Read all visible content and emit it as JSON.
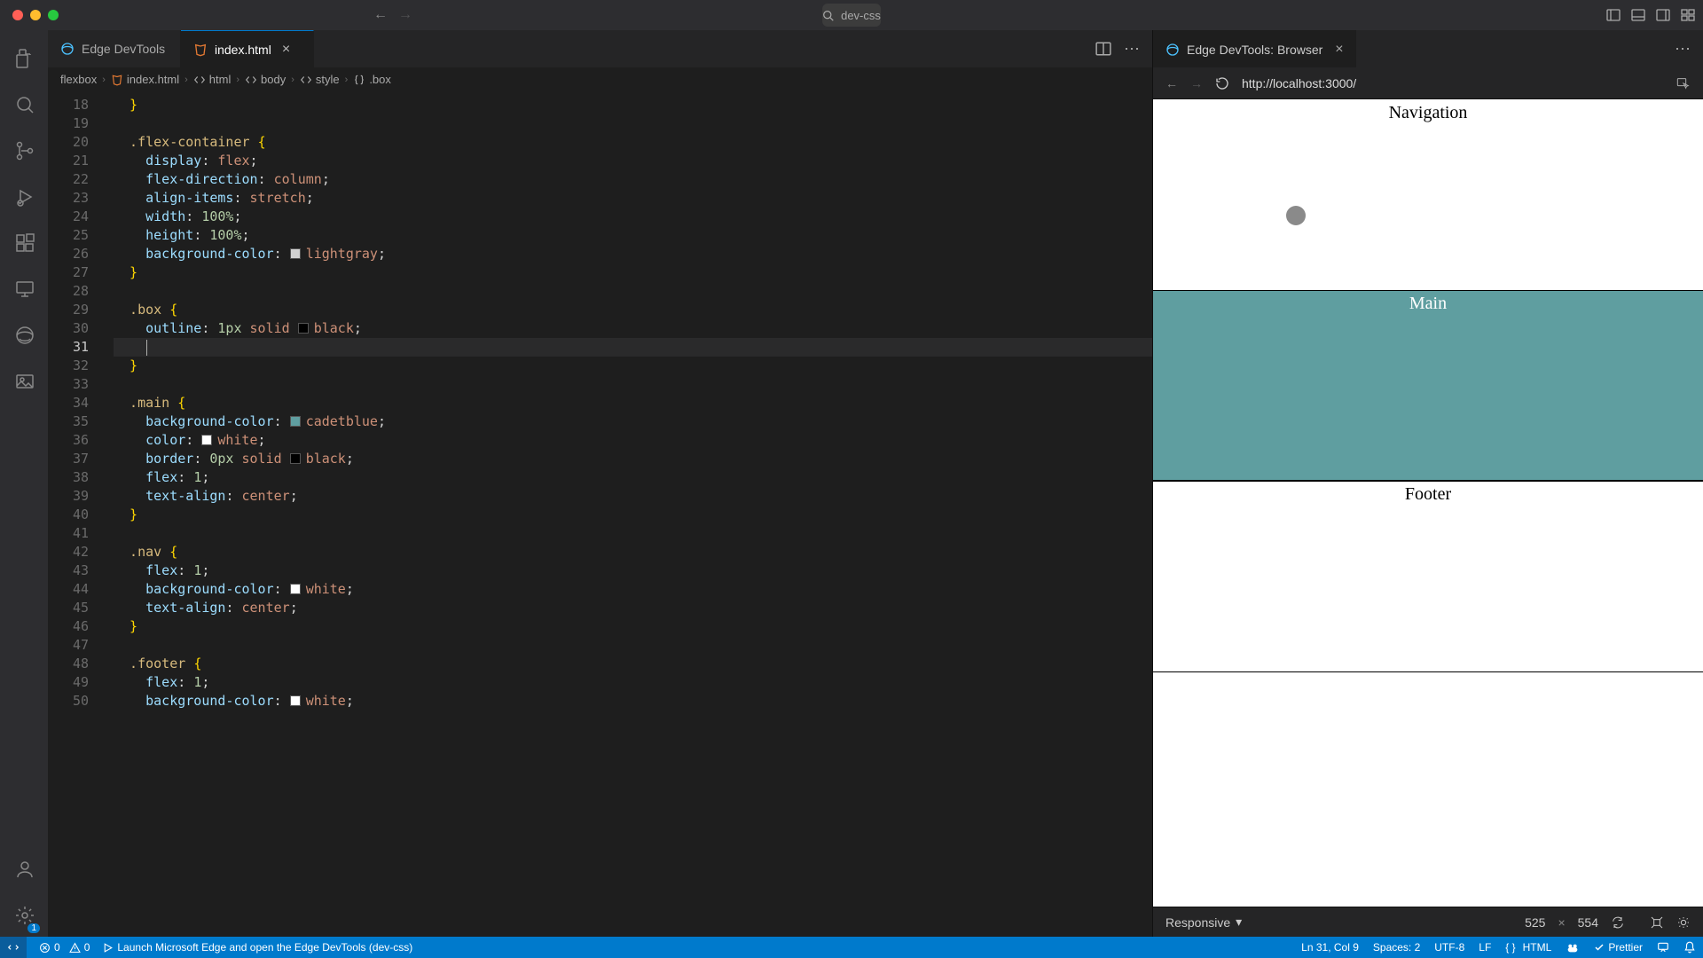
{
  "title_search": "dev-css",
  "traffic": {
    "close": "close",
    "min": "min",
    "max": "max"
  },
  "tabs": [
    {
      "icon": "edge",
      "label": "Edge DevTools",
      "closable": false,
      "active": false
    },
    {
      "icon": "html",
      "label": "index.html",
      "closable": true,
      "active": true
    }
  ],
  "browser_tab": {
    "icon": "edge",
    "label": "Edge DevTools: Browser",
    "closable": true
  },
  "breadcrumbs": [
    {
      "icon": "",
      "label": "flexbox"
    },
    {
      "icon": "html",
      "label": "index.html"
    },
    {
      "icon": "tag",
      "label": "html"
    },
    {
      "icon": "tag",
      "label": "body"
    },
    {
      "icon": "tag",
      "label": "style"
    },
    {
      "icon": "brace",
      "label": ".box"
    }
  ],
  "url": "http://localhost:3000/",
  "device": {
    "mode": "Responsive",
    "w": "525",
    "h": "554"
  },
  "preview": {
    "nav": "Navigation",
    "main": "Main",
    "footer": "Footer"
  },
  "gutter_start": 18,
  "current_line_index": 13,
  "code_lines": [
    {
      "raw": "  }",
      "t": [
        [
          "brace",
          "  }"
        ]
      ]
    },
    {
      "raw": "",
      "t": []
    },
    {
      "raw": "  .flex-container {",
      "t": [
        [
          "sel",
          "  .flex-container "
        ],
        [
          "brace",
          "{"
        ]
      ]
    },
    {
      "raw": "    display: flex;",
      "t": [
        [
          "prop",
          "    display"
        ],
        [
          "punc",
          ": "
        ],
        [
          "val",
          "flex"
        ],
        [
          "punc",
          ";"
        ]
      ]
    },
    {
      "raw": "    flex-direction: column;",
      "t": [
        [
          "prop",
          "    flex-direction"
        ],
        [
          "punc",
          ": "
        ],
        [
          "val",
          "column"
        ],
        [
          "punc",
          ";"
        ]
      ]
    },
    {
      "raw": "    align-items: stretch;",
      "t": [
        [
          "prop",
          "    align-items"
        ],
        [
          "punc",
          ": "
        ],
        [
          "val",
          "stretch"
        ],
        [
          "punc",
          ";"
        ]
      ]
    },
    {
      "raw": "    width: 100%;",
      "t": [
        [
          "prop",
          "    width"
        ],
        [
          "punc",
          ": "
        ],
        [
          "num",
          "100%"
        ],
        [
          "punc",
          ";"
        ]
      ]
    },
    {
      "raw": "    height: 100%;",
      "t": [
        [
          "prop",
          "    height"
        ],
        [
          "punc",
          ": "
        ],
        [
          "num",
          "100%"
        ],
        [
          "punc",
          ";"
        ]
      ]
    },
    {
      "raw": "    background-color: lightgray;",
      "t": [
        [
          "prop",
          "    background-color"
        ],
        [
          "punc",
          ": "
        ],
        [
          "sw",
          "#d3d3d3"
        ],
        [
          "colname",
          "lightgray"
        ],
        [
          "punc",
          ";"
        ]
      ]
    },
    {
      "raw": "  }",
      "t": [
        [
          "brace",
          "  }"
        ]
      ]
    },
    {
      "raw": "",
      "t": []
    },
    {
      "raw": "  .box {",
      "t": [
        [
          "sel",
          "  .box "
        ],
        [
          "brace",
          "{"
        ]
      ]
    },
    {
      "raw": "    outline: 1px solid black;",
      "t": [
        [
          "prop",
          "    outline"
        ],
        [
          "punc",
          ": "
        ],
        [
          "num",
          "1px "
        ],
        [
          "val",
          "solid "
        ],
        [
          "sw",
          "#000000"
        ],
        [
          "colname",
          "black"
        ],
        [
          "punc",
          ";"
        ]
      ]
    },
    {
      "raw": "    ",
      "t": [
        [
          "punc",
          "    "
        ],
        [
          "cursor",
          ""
        ]
      ]
    },
    {
      "raw": "  }",
      "t": [
        [
          "brace",
          "  }"
        ]
      ]
    },
    {
      "raw": "",
      "t": []
    },
    {
      "raw": "  .main {",
      "t": [
        [
          "sel",
          "  .main "
        ],
        [
          "brace",
          "{"
        ]
      ]
    },
    {
      "raw": "    background-color: cadetblue;",
      "t": [
        [
          "prop",
          "    background-color"
        ],
        [
          "punc",
          ": "
        ],
        [
          "sw",
          "#5f9ea0"
        ],
        [
          "colname",
          "cadetblue"
        ],
        [
          "punc",
          ";"
        ]
      ]
    },
    {
      "raw": "    color: white;",
      "t": [
        [
          "prop",
          "    color"
        ],
        [
          "punc",
          ": "
        ],
        [
          "sw",
          "#ffffff"
        ],
        [
          "colname",
          "white"
        ],
        [
          "punc",
          ";"
        ]
      ]
    },
    {
      "raw": "    border: 0px solid black;",
      "t": [
        [
          "prop",
          "    border"
        ],
        [
          "punc",
          ": "
        ],
        [
          "num",
          "0px "
        ],
        [
          "val",
          "solid "
        ],
        [
          "sw",
          "#000000"
        ],
        [
          "colname",
          "black"
        ],
        [
          "punc",
          ";"
        ]
      ]
    },
    {
      "raw": "    flex: 1;",
      "t": [
        [
          "prop",
          "    flex"
        ],
        [
          "punc",
          ": "
        ],
        [
          "num",
          "1"
        ],
        [
          "punc",
          ";"
        ]
      ]
    },
    {
      "raw": "    text-align: center;",
      "t": [
        [
          "prop",
          "    text-align"
        ],
        [
          "punc",
          ": "
        ],
        [
          "val",
          "center"
        ],
        [
          "punc",
          ";"
        ]
      ]
    },
    {
      "raw": "  }",
      "t": [
        [
          "brace",
          "  }"
        ]
      ]
    },
    {
      "raw": "",
      "t": []
    },
    {
      "raw": "  .nav {",
      "t": [
        [
          "sel",
          "  .nav "
        ],
        [
          "brace",
          "{"
        ]
      ]
    },
    {
      "raw": "    flex: 1;",
      "t": [
        [
          "prop",
          "    flex"
        ],
        [
          "punc",
          ": "
        ],
        [
          "num",
          "1"
        ],
        [
          "punc",
          ";"
        ]
      ]
    },
    {
      "raw": "    background-color: white;",
      "t": [
        [
          "prop",
          "    background-color"
        ],
        [
          "punc",
          ": "
        ],
        [
          "sw",
          "#ffffff"
        ],
        [
          "colname",
          "white"
        ],
        [
          "punc",
          ";"
        ]
      ]
    },
    {
      "raw": "    text-align: center;",
      "t": [
        [
          "prop",
          "    text-align"
        ],
        [
          "punc",
          ": "
        ],
        [
          "val",
          "center"
        ],
        [
          "punc",
          ";"
        ]
      ]
    },
    {
      "raw": "  }",
      "t": [
        [
          "brace",
          "  }"
        ]
      ]
    },
    {
      "raw": "",
      "t": []
    },
    {
      "raw": "  .footer {",
      "t": [
        [
          "sel",
          "  .footer "
        ],
        [
          "brace",
          "{"
        ]
      ]
    },
    {
      "raw": "    flex: 1;",
      "t": [
        [
          "prop",
          "    flex"
        ],
        [
          "punc",
          ": "
        ],
        [
          "num",
          "1"
        ],
        [
          "punc",
          ";"
        ]
      ]
    },
    {
      "raw": "    background-color: white;",
      "t": [
        [
          "prop",
          "    background-color"
        ],
        [
          "punc",
          ": "
        ],
        [
          "sw",
          "#ffffff"
        ],
        [
          "colname",
          "white"
        ],
        [
          "punc",
          ";"
        ]
      ]
    }
  ],
  "status": {
    "remote": "><",
    "errors": "0",
    "warnings": "0",
    "launch": "Launch Microsoft Edge and open the Edge DevTools (dev-css)",
    "lncol": "Ln 31, Col 9",
    "spaces": "Spaces: 2",
    "encoding": "UTF-8",
    "eol": "LF",
    "lang": "HTML",
    "prettier": "Prettier"
  },
  "icons": {
    "search": "⌕",
    "arrow_left": "←",
    "arrow_right": "→",
    "reload": "⟳",
    "more": "⋯",
    "split": "▯▯",
    "dots": "⋯",
    "chevron": "▾",
    "x": "×",
    "layout1": "▯",
    "layout2": "▭",
    "layout3": "▦",
    "layout4": "▥"
  }
}
